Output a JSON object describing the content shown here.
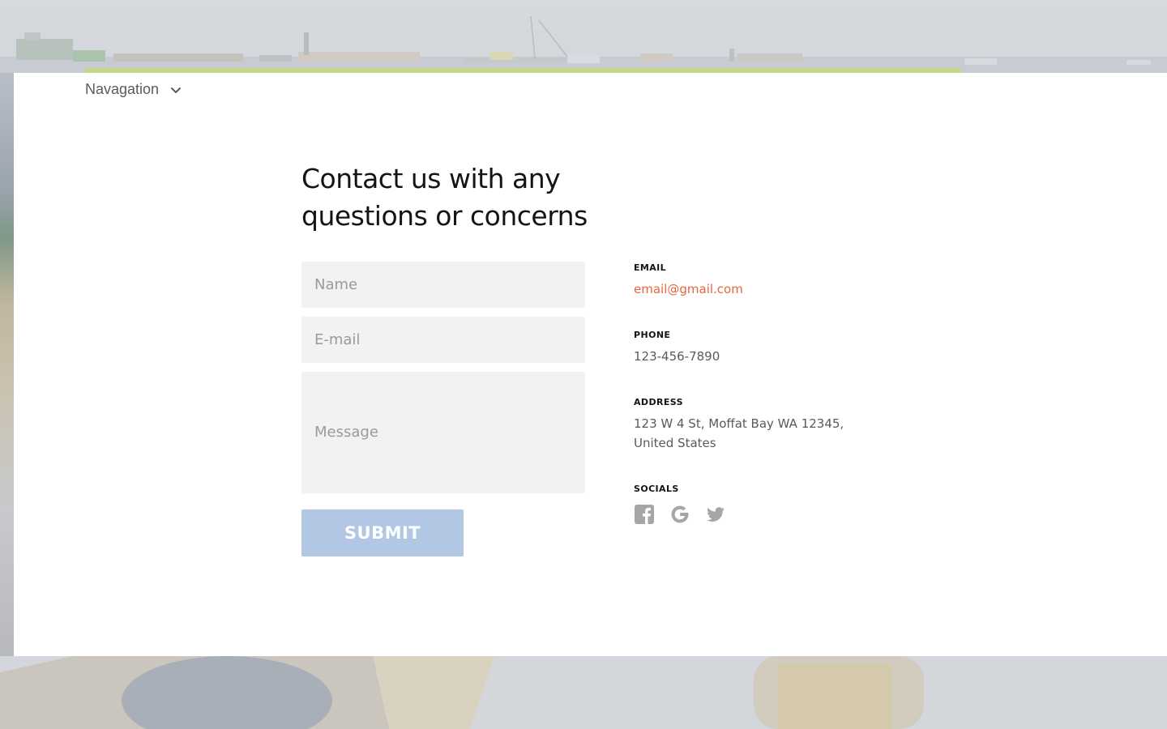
{
  "nav": {
    "label": "Navagation"
  },
  "contact": {
    "heading": "Contact us with any questions or concerns",
    "form": {
      "name_placeholder": "Name",
      "email_placeholder": "E-mail",
      "message_placeholder": "Message",
      "submit_label": "SUBMIT"
    },
    "info": {
      "email_label": "EMAIL",
      "email_value": "email@gmail.com",
      "phone_label": "PHONE",
      "phone_value": "123-456-7890",
      "address_label": "ADDRESS",
      "address_line1": "123 W 4 St, Moffat Bay WA 12345,",
      "address_line2": "United States",
      "socials_label": "SOCIALS",
      "socials": [
        "facebook-icon",
        "google-icon",
        "twitter-icon"
      ]
    }
  },
  "colors": {
    "accent_link": "#e8663d",
    "submit_bg": "#b1c7e3",
    "top_bar": "#c2d68b",
    "field_bg": "#f2f2f2",
    "icon_gray": "#a6a6a6"
  }
}
